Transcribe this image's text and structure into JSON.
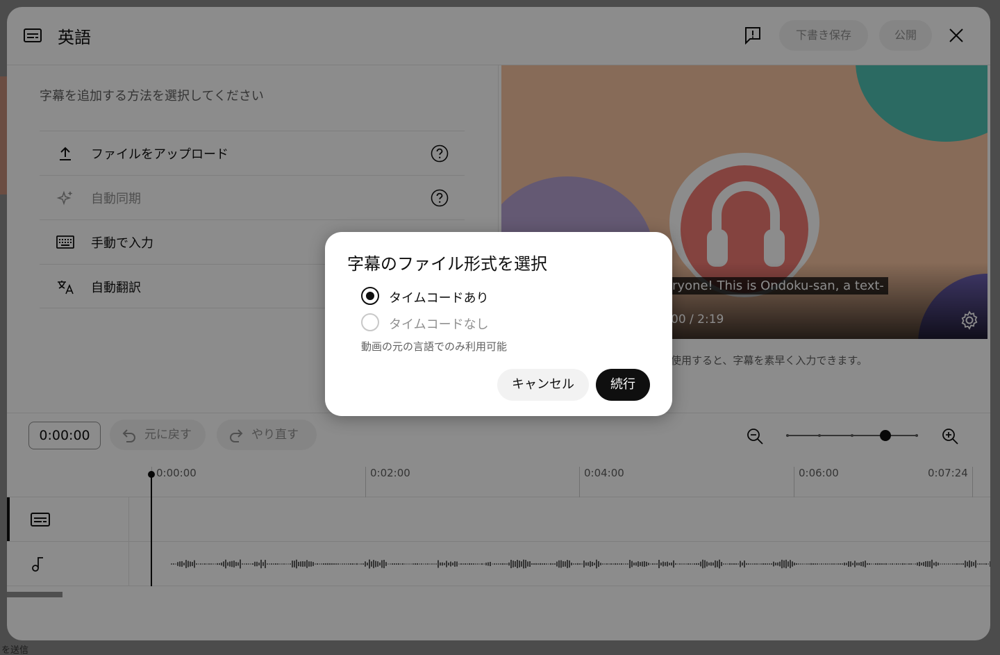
{
  "background": {
    "footer_text": "を送信"
  },
  "editor": {
    "title": "英語",
    "header": {
      "save_draft": "下書き保存",
      "publish": "公開"
    },
    "left_panel": {
      "prompt": "字幕を追加する方法を選択してください",
      "methods": [
        {
          "label": "ファイルをアップロード",
          "icon": "upload-icon",
          "disabled": false,
          "help": true
        },
        {
          "label": "自動同期",
          "icon": "sparkle-icon",
          "disabled": true,
          "help": true
        },
        {
          "label": "手動で入力",
          "icon": "keyboard-icon",
          "disabled": false,
          "help": false
        },
        {
          "label": "自動翻訳",
          "icon": "translate-icon",
          "disabled": false,
          "help": false
        }
      ]
    },
    "video": {
      "caption": "ryone! This is Ondoku-san, a text-",
      "time": "00 / 2:19",
      "tip": "使用すると、字幕を素早く入力できます。"
    },
    "toolbar": {
      "timecode": "0:00:00",
      "undo": "元に戻す",
      "redo": "やり直す",
      "zoom_level": 0.75
    },
    "ruler": [
      "0:00:00",
      "0:02:00",
      "0:04:00",
      "0:06:00",
      "0:07:24"
    ]
  },
  "dialog": {
    "title": "字幕のファイル形式を選択",
    "options": [
      {
        "label": "タイムコードあり",
        "selected": true,
        "disabled": false
      },
      {
        "label": "タイムコードなし",
        "selected": false,
        "disabled": true
      }
    ],
    "note": "動画の元の言語でのみ利用可能",
    "cancel": "キャンセル",
    "continue": "続行"
  }
}
